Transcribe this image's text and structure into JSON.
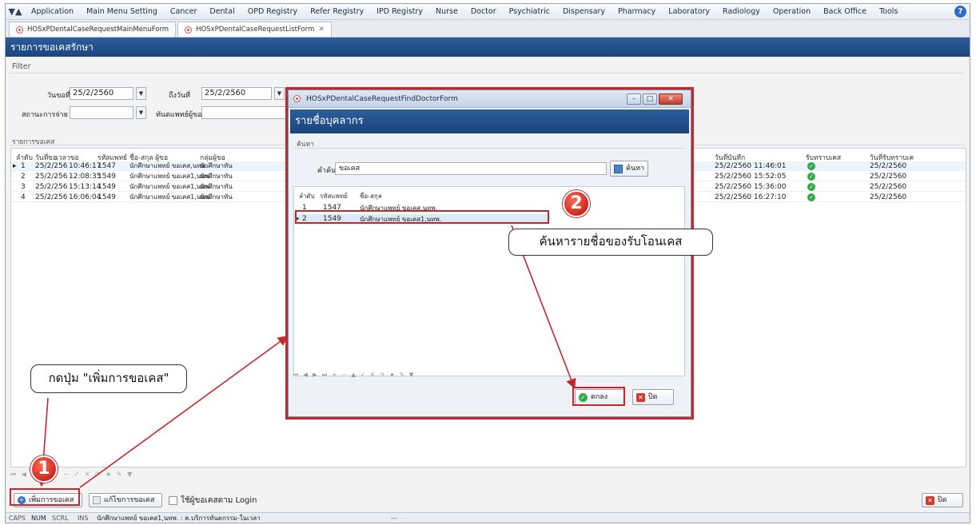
{
  "menu": [
    "Application",
    "Main Menu Setting",
    "Cancer",
    "Dental",
    "OPD Registry",
    "Refer Registry",
    "IPD Registry",
    "Nurse",
    "Doctor",
    "Psychiatric",
    "Dispensary",
    "Pharmacy",
    "Laboratory",
    "Radiology",
    "Operation",
    "Back Office",
    "Tools"
  ],
  "tabs": [
    {
      "label": "HOSxPDentalCaseRequestMainMenuForm",
      "active": false
    },
    {
      "label": "HOSxPDentalCaseRequestListForm",
      "active": true
    }
  ],
  "form_title": "รายการขอเคสรักษา",
  "filter": {
    "title": "Filter",
    "date_from_label": "วันขอที่",
    "date_from_value": "25/2/2560",
    "date_to_label": "ถึงวันที่",
    "date_to_value": "25/2/2560",
    "status_label": "สถานะการจ่าย",
    "status_value": "",
    "requester_label": "ทันตแพทย์ผู้ขอ",
    "requester_value": ""
  },
  "list": {
    "title": "รายการขอเคส",
    "columns": [
      "ลำดับ",
      "วันที่ขอ",
      "เวลาขอ",
      "รหัสแพทย์",
      "ชื่อ-สกุล ผู้ขอ",
      "กลุ่มผู้ขอ",
      "วันที่บันทึก",
      "รับทราบเคส",
      "วันที่รับทราบเค"
    ],
    "rows": [
      {
        "no": "1",
        "date": "25/2/256",
        "time": "10:46:17",
        "doctor_code": "1547",
        "name": "นักศึกษาแพทย์ ขอเคส,นทพ.",
        "group": "นักศึกษาทัน",
        "saved": "25/2/2560 11:46:01",
        "ack_date": "25/2/2560"
      },
      {
        "no": "2",
        "date": "25/2/256",
        "time": "12:08:35",
        "doctor_code": "1549",
        "name": "นักศึกษาแพทย์ ขอเคส1,นทพ.",
        "group": "นักศึกษาทัน",
        "saved": "25/2/2560 15:52:05",
        "ack_date": "25/2/2560"
      },
      {
        "no": "3",
        "date": "25/2/256",
        "time": "15:13:14",
        "doctor_code": "1549",
        "name": "นักศึกษาแพทย์ ขอเคส1,นทพ.",
        "group": "นักศึกษาทัน",
        "saved": "25/2/2560 15:36:00",
        "ack_date": "25/2/2560"
      },
      {
        "no": "4",
        "date": "25/2/256",
        "time": "16:06:04",
        "doctor_code": "1549",
        "name": "นักศึกษาแพทย์ ขอเคส1,นทพ.",
        "group": "นักศึกษาทัน",
        "saved": "25/2/2560 16:27:10",
        "ack_date": "25/2/2560"
      }
    ]
  },
  "buttons": {
    "add_request": "เพิ่มการขอเคส",
    "edit_request": "แก้ไขการขอเคส",
    "login_checkbox": "ใช้ผู้ขอเคสตาม Login",
    "close": "ปิด"
  },
  "status_bar": {
    "caps": "CAPS",
    "num": "NUM",
    "scrl": "SCRL",
    "ins": "INS",
    "user": "นักศึกษาแพทย์ ขอเคส1,นทพ. : ค.บริการทันตกรรม-ในเวลา",
    "extra": "---"
  },
  "dialog": {
    "window_title": "HOSxPDentalCaseRequestFindDoctorForm",
    "header": "รายชื่อบุคลากร",
    "search_title": "ค้นหา",
    "keyword_label": "คำค้น",
    "keyword_value": "ขอเคส",
    "find_button": "ค้นหา",
    "columns": [
      "ลำดับ",
      "รหัสแพทย์",
      "ชื่อ-สกุล"
    ],
    "rows": [
      {
        "no": "1",
        "code": "1547",
        "name": "นักศึกษาแพทย์ ขอเคส,นทพ."
      },
      {
        "no": "2",
        "code": "1549",
        "name": "นักศึกษาแพทย์ ขอเคส1,นทพ."
      }
    ],
    "selected_row": 2,
    "ok_button": "ตกลง",
    "close_button": "ปิด"
  },
  "annotations": {
    "step1": "1",
    "step2": "2",
    "callout1": "กดปุ่ม \"เพิ่มการขอเคส\"",
    "callout2": "ค้นหารายชื่อของรับโอนเคส"
  },
  "colors": {
    "header_blue": "#1b447e",
    "annotation_red": "#c5282c",
    "ok_green": "#35a94a"
  }
}
